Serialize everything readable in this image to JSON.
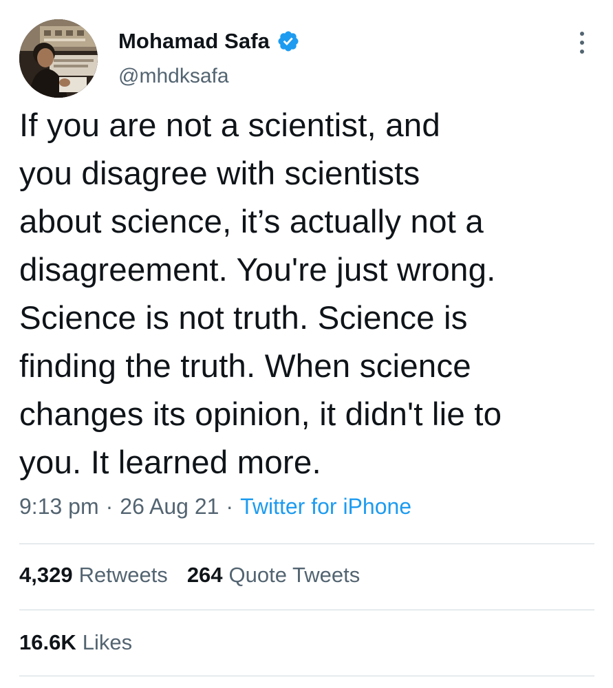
{
  "user": {
    "display_name": "Mohamad Safa",
    "handle": "@mhdksafa",
    "verified": true,
    "avatar_icon": "profile-photo"
  },
  "tweet": {
    "text": "If you are not a scientist, and\nyou disagree with scientists\nabout science, it’s actually not a\ndisagreement. You're just wrong.\nScience is not truth. Science is\nfinding the truth. When science\nchanges its opinion, it didn't lie to\nyou. It learned more.",
    "time": "9:13 pm",
    "date": "26 Aug 21",
    "source": "Twitter for iPhone",
    "separator": "·"
  },
  "stats": {
    "retweets_count": "4,329",
    "retweets_label": "Retweets",
    "quotes_count": "264",
    "quotes_label": "Quote Tweets",
    "likes_count": "16.6K",
    "likes_label": "Likes"
  },
  "colors": {
    "text_primary": "#0f1419",
    "text_secondary": "#536471",
    "accent_blue": "#1d9bf0",
    "divider": "#cfd9de"
  }
}
